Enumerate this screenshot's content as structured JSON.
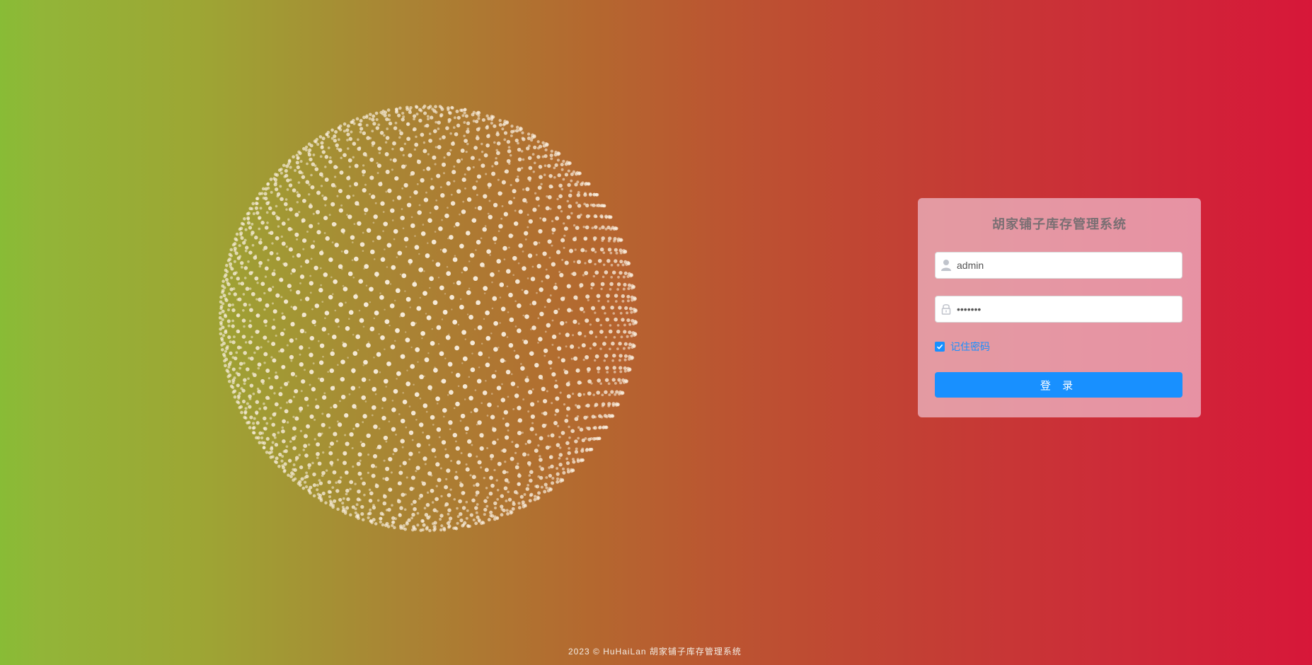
{
  "login": {
    "title": "胡家铺子库存管理系统",
    "username_value": "admin",
    "password_value": "•••••••",
    "remember_label": "记住密码",
    "remember_checked": true,
    "submit_label": "登 录"
  },
  "footer": {
    "text": "2023 © HuHaiLan 胡家铺子库存管理系统"
  },
  "colors": {
    "accent": "#1890ff",
    "background_left": "#8fb939",
    "background_right": "#d71739"
  },
  "icons": {
    "username": "user-icon",
    "password": "lock-icon",
    "remember": "check-icon"
  }
}
